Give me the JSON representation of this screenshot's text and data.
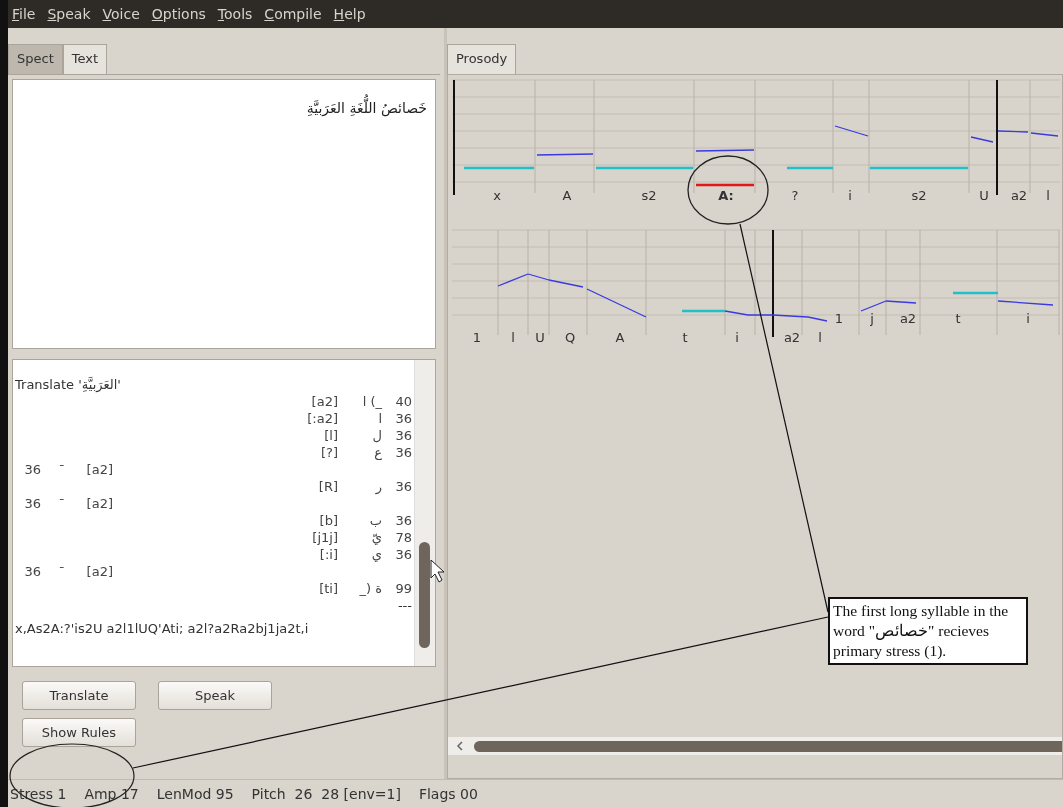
{
  "menu": [
    "File",
    "Speak",
    "Voice",
    "Options",
    "Tools",
    "Compile",
    "Help"
  ],
  "left_tabs": [
    {
      "label": "Spect",
      "selected": false
    },
    {
      "label": "Text",
      "selected": true
    }
  ],
  "text_input": "خَصائصُ اللُّغَةِ العَرَبيَّةِ",
  "log": [
    {
      "kind": "heading",
      "text": "Translate 'العَرَبيَّةِ'"
    },
    {
      "kind": "rule",
      "phoneme": "[a2]",
      "letters": "ا (_",
      "score": "40"
    },
    {
      "kind": "rule",
      "phoneme": "[:a2]",
      "letters": "ا",
      "score": "36"
    },
    {
      "kind": "rule",
      "phoneme": "[l]",
      "letters": "ل",
      "score": "36"
    },
    {
      "kind": "rule",
      "phoneme": "[?]",
      "letters": "ع",
      "score": "36"
    },
    {
      "kind": "vowel",
      "score": "36",
      "mark": "ˉ",
      "phoneme": "[a2]"
    },
    {
      "kind": "rule",
      "phoneme": "[R]",
      "letters": "ر",
      "score": "36"
    },
    {
      "kind": "vowel",
      "score": "36",
      "mark": "ˉ",
      "phoneme": "[a2]"
    },
    {
      "kind": "rule",
      "phoneme": "[b]",
      "letters": "ب",
      "score": "36"
    },
    {
      "kind": "rule",
      "phoneme": "[j1j]",
      "letters": "يّ",
      "score": "78"
    },
    {
      "kind": "rule",
      "phoneme": "[:i]",
      "letters": "ي",
      "score": "36"
    },
    {
      "kind": "vowel",
      "score": "36",
      "mark": "ˉ",
      "phoneme": "[a2]"
    },
    {
      "kind": "rule",
      "phoneme": "[ti]",
      "letters": "_) ة",
      "score": "99"
    },
    {
      "kind": "separator",
      "text": "---"
    },
    {
      "kind": "result",
      "text": "x,As2A:?'is2U a2l1lUQ'Ati; a2l?a2Ra2bj1ja2t,i"
    }
  ],
  "buttons": [
    "Translate",
    "Speak",
    "Show Rules"
  ],
  "prosody_tab": {
    "label": "Prosody",
    "selected": true
  },
  "prosody_rows": [
    {
      "phonemes": [
        {
          "label": "x",
          "kind": "unvoiced",
          "stressed": false
        },
        {
          "label": "A",
          "kind": "voiced",
          "stressed": false
        },
        {
          "label": "s2",
          "kind": "unvoiced",
          "stressed": false
        },
        {
          "label": "A:",
          "kind": "voiced",
          "stressed": true
        },
        {
          "label": "?",
          "kind": "unvoiced",
          "stressed": false
        },
        {
          "label": "i",
          "kind": "voiced",
          "stressed": false
        },
        {
          "label": "s2",
          "kind": "unvoiced",
          "stressed": false
        },
        {
          "label": "U",
          "kind": "voiced",
          "stressed": false
        },
        {
          "label": "a2",
          "kind": "voiced",
          "stressed": false
        },
        {
          "label": "l",
          "kind": "voiced",
          "stressed": false
        }
      ]
    },
    {
      "phonemes": [
        {
          "label": "1",
          "kind": "silent",
          "stressed": false
        },
        {
          "label": "l",
          "kind": "voiced",
          "stressed": false
        },
        {
          "label": "U",
          "kind": "voiced",
          "stressed": false
        },
        {
          "label": "Q",
          "kind": "voiced",
          "stressed": false
        },
        {
          "label": "A",
          "kind": "voiced",
          "stressed": false
        },
        {
          "label": "t",
          "kind": "unvoiced",
          "stressed": false
        },
        {
          "label": "i",
          "kind": "voiced",
          "stressed": false
        },
        {
          "label": "a2",
          "kind": "voiced",
          "stressed": false
        },
        {
          "label": "l",
          "kind": "voiced",
          "stressed": false
        },
        {
          "label": "1",
          "kind": "silent",
          "stressed": false
        },
        {
          "label": "j",
          "kind": "voiced",
          "stressed": false
        },
        {
          "label": "a2",
          "kind": "voiced",
          "stressed": false
        },
        {
          "label": "t",
          "kind": "unvoiced",
          "stressed": false
        },
        {
          "label": "i",
          "kind": "voiced",
          "stressed": false
        }
      ]
    }
  ],
  "annotation": "The first long syllable in the word \"خصائص\" recieves primary stress (1).",
  "status": [
    "Stress 1",
    "Amp 17",
    "LenMod 95",
    "Pitch  26  28 [env=1]",
    "Flags 00"
  ]
}
